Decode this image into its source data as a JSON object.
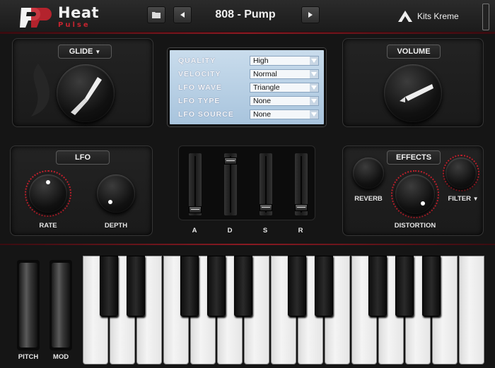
{
  "header": {
    "brand_name": "Heat",
    "brand_sub": "Pulse",
    "preset_name": "808 - Pump",
    "maker": "Kits Kreme"
  },
  "glide": {
    "label": "GLIDE"
  },
  "volume": {
    "label": "VOLUME"
  },
  "lcd": {
    "rows": [
      {
        "label": "QUALITY",
        "value": "High"
      },
      {
        "label": "VELOCITY",
        "value": "Normal"
      },
      {
        "label": "LFO WAVE",
        "value": "Triangle"
      },
      {
        "label": "LFO TYPE",
        "value": "None"
      },
      {
        "label": "LFO SOURCE",
        "value": "None"
      }
    ]
  },
  "lfo": {
    "label": "LFO",
    "rate_label": "RATE",
    "depth_label": "DEPTH"
  },
  "adsr": {
    "labels": [
      "A",
      "D",
      "S",
      "R"
    ],
    "levels": [
      0.02,
      0.95,
      0.05,
      0.05
    ]
  },
  "effects": {
    "label": "EFFECTS",
    "reverb_label": "REVERB",
    "distortion_label": "DISTORTION",
    "filter_label": "FILTER"
  },
  "wheels": {
    "pitch_label": "PITCH",
    "mod_label": "MOD"
  },
  "colors": {
    "accent": "#c4242f",
    "lcd": "#b8d0e6"
  }
}
